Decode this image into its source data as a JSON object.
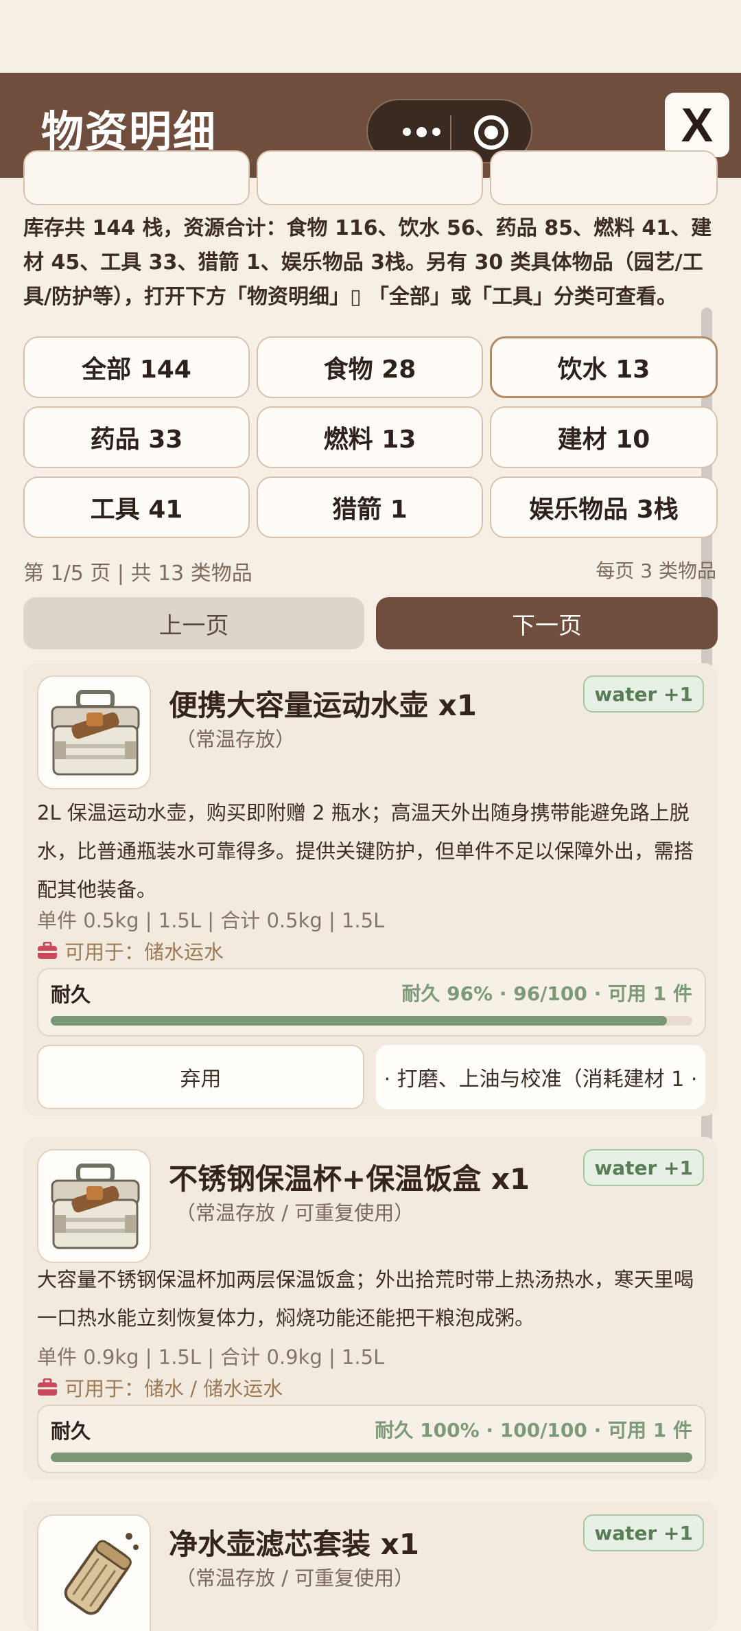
{
  "header": {
    "title": "物资明细",
    "close_label": "X"
  },
  "summary": "库存共 144 栈，资源合计：食物 116、饮水 56、药品 85、燃料 41、建材 45、工具 33、猎箭 1、娱乐物品 3栈。另有 30 类具体物品（园艺/工具/防护等），打开下方「物资明细」▯ 「全部」或「工具」分类可查看。",
  "filters": [
    {
      "label": "全部 144",
      "active": false
    },
    {
      "label": "食物 28",
      "active": false
    },
    {
      "label": "饮水 13",
      "active": true
    },
    {
      "label": "药品 33",
      "active": false
    },
    {
      "label": "燃料 13",
      "active": false
    },
    {
      "label": "建材 10",
      "active": false
    },
    {
      "label": "工具 41",
      "active": false
    },
    {
      "label": "猎箭 1",
      "active": false
    },
    {
      "label": "娱乐物品 3栈",
      "active": false
    }
  ],
  "pager": {
    "info": "第 1/5 页 | 共 13 类物品",
    "per_page": "每页 3 类物品",
    "prev_label": "上一页",
    "next_label": "下一页"
  },
  "items": [
    {
      "title": "便携大容量运动水壶 x1",
      "meta": "（常温存放）",
      "tag": "water +1",
      "desc": "2L 保温运动水壶，购买即附赠 2 瓶水；高温天外出随身携带能避免路上脱水，比普通瓶装水可靠得多。提供关键防护，但单件不足以保障外出，需搭配其他装备。",
      "weight": "单件 0.5kg | 1.5L | 合计 0.5kg | 1.5L",
      "use": "可用于：储水运水",
      "durability_label": "耐久",
      "durability_stats": "耐久 96% · 96/100 · 可用 1 件",
      "durability": 0.96,
      "discard_label": "弃用",
      "repair_label": "· 打磨、上油与校准（消耗建材 1 ·",
      "icon": "toolbox-icon"
    },
    {
      "title": "不锈钢保温杯+保温饭盒 x1",
      "meta": "（常温存放 / 可重复使用）",
      "tag": "water +1",
      "desc": "大容量不锈钢保温杯加两层保温饭盒；外出拾荒时带上热汤热水，寒天里喝一口热水能立刻恢复体力，焖烧功能还能把干粮泡成粥。",
      "weight": "单件 0.9kg | 1.5L | 合计 0.9kg | 1.5L",
      "use": "可用于：储水 / 储水运水",
      "durability_label": "耐久",
      "durability_stats": "耐久 100% · 100/100 · 可用 1 件",
      "durability": 1.0,
      "icon": "toolbox-icon"
    },
    {
      "title": "净水壶滤芯套装 x1",
      "meta": "（常温存放 / 可重复使用）",
      "tag": "water +1",
      "icon": "filter-cartridge-icon"
    }
  ]
}
